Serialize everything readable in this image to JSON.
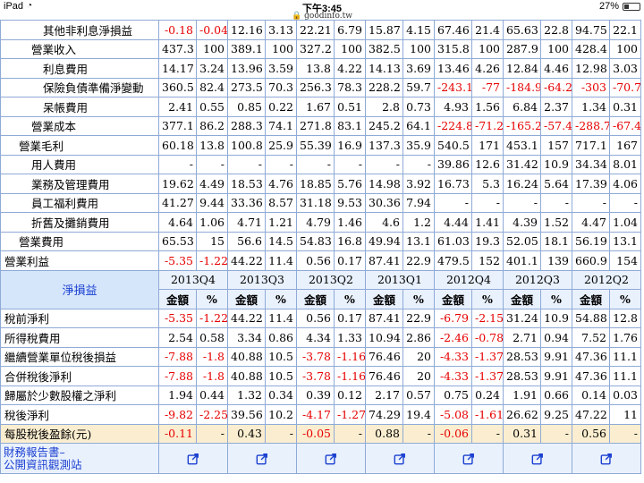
{
  "status_bar": {
    "device": "iPad",
    "time": "下午3:45",
    "url": "goodinfo.tw",
    "battery": "27%"
  },
  "income_rows": [
    {
      "label": "其他非利息淨損益",
      "indent": 3,
      "cells": [
        [
          "-0.18",
          true
        ],
        [
          "-0.04",
          true
        ],
        [
          "12.16",
          false
        ],
        [
          "3.13",
          false
        ],
        [
          "22.21",
          false
        ],
        [
          "6.79",
          false
        ],
        [
          "15.87",
          false
        ],
        [
          "4.15",
          false
        ],
        [
          "67.46",
          false
        ],
        [
          "21.4",
          false
        ],
        [
          "65.63",
          false
        ],
        [
          "22.8",
          false
        ],
        [
          "94.75",
          false
        ],
        [
          "22.1",
          false
        ]
      ]
    },
    {
      "label": "營業收入",
      "indent": 2,
      "cells": [
        [
          "437.3",
          false
        ],
        [
          "100",
          false
        ],
        [
          "389.1",
          false
        ],
        [
          "100",
          false
        ],
        [
          "327.2",
          false
        ],
        [
          "100",
          false
        ],
        [
          "382.5",
          false
        ],
        [
          "100",
          false
        ],
        [
          "315.8",
          false
        ],
        [
          "100",
          false
        ],
        [
          "287.9",
          false
        ],
        [
          "100",
          false
        ],
        [
          "428.4",
          false
        ],
        [
          "100",
          false
        ]
      ]
    },
    {
      "label": "利息費用",
      "indent": 3,
      "cells": [
        [
          "14.17",
          false
        ],
        [
          "3.24",
          false
        ],
        [
          "13.96",
          false
        ],
        [
          "3.59",
          false
        ],
        [
          "13.8",
          false
        ],
        [
          "4.22",
          false
        ],
        [
          "14.13",
          false
        ],
        [
          "3.69",
          false
        ],
        [
          "13.46",
          false
        ],
        [
          "4.26",
          false
        ],
        [
          "12.84",
          false
        ],
        [
          "4.46",
          false
        ],
        [
          "12.98",
          false
        ],
        [
          "3.03",
          false
        ]
      ]
    },
    {
      "label": "保險負債準備淨變動",
      "indent": 3,
      "cells": [
        [
          "360.5",
          false
        ],
        [
          "82.4",
          false
        ],
        [
          "273.5",
          false
        ],
        [
          "70.3",
          false
        ],
        [
          "256.3",
          false
        ],
        [
          "78.3",
          false
        ],
        [
          "228.2",
          false
        ],
        [
          "59.7",
          false
        ],
        [
          "-243.1",
          true
        ],
        [
          "-77",
          true
        ],
        [
          "-184.9",
          true
        ],
        [
          "-64.2",
          true
        ],
        [
          "-303",
          true
        ],
        [
          "-70.7",
          true
        ]
      ]
    },
    {
      "label": "呆帳費用",
      "indent": 3,
      "cells": [
        [
          "2.41",
          false
        ],
        [
          "0.55",
          false
        ],
        [
          "0.85",
          false
        ],
        [
          "0.22",
          false
        ],
        [
          "1.67",
          false
        ],
        [
          "0.51",
          false
        ],
        [
          "2.8",
          false
        ],
        [
          "0.73",
          false
        ],
        [
          "4.93",
          false
        ],
        [
          "1.56",
          false
        ],
        [
          "6.84",
          false
        ],
        [
          "2.37",
          false
        ],
        [
          "1.34",
          false
        ],
        [
          "0.31",
          false
        ]
      ]
    },
    {
      "label": "營業成本",
      "indent": 2,
      "cells": [
        [
          "377.1",
          false
        ],
        [
          "86.2",
          false
        ],
        [
          "288.3",
          false
        ],
        [
          "74.1",
          false
        ],
        [
          "271.8",
          false
        ],
        [
          "83.1",
          false
        ],
        [
          "245.2",
          false
        ],
        [
          "64.1",
          false
        ],
        [
          "-224.8",
          true
        ],
        [
          "-71.2",
          true
        ],
        [
          "-165.2",
          true
        ],
        [
          "-57.4",
          true
        ],
        [
          "-288.7",
          true
        ],
        [
          "-67.4",
          true
        ]
      ]
    },
    {
      "label": "營業毛利",
      "indent": 1,
      "cells": [
        [
          "60.18",
          false
        ],
        [
          "13.8",
          false
        ],
        [
          "100.8",
          false
        ],
        [
          "25.9",
          false
        ],
        [
          "55.39",
          false
        ],
        [
          "16.9",
          false
        ],
        [
          "137.3",
          false
        ],
        [
          "35.9",
          false
        ],
        [
          "540.5",
          false
        ],
        [
          "171",
          false
        ],
        [
          "453.1",
          false
        ],
        [
          "157",
          false
        ],
        [
          "717.1",
          false
        ],
        [
          "167",
          false
        ]
      ]
    },
    {
      "label": "用人費用",
      "indent": 2,
      "cells": [
        [
          "-",
          false
        ],
        [
          "-",
          false
        ],
        [
          "-",
          false
        ],
        [
          "-",
          false
        ],
        [
          "-",
          false
        ],
        [
          "-",
          false
        ],
        [
          "-",
          false
        ],
        [
          "-",
          false
        ],
        [
          "39.86",
          false
        ],
        [
          "12.6",
          false
        ],
        [
          "31.42",
          false
        ],
        [
          "10.9",
          false
        ],
        [
          "34.34",
          false
        ],
        [
          "8.01",
          false
        ]
      ]
    },
    {
      "label": "業務及管理費用",
      "indent": 2,
      "cells": [
        [
          "19.62",
          false
        ],
        [
          "4.49",
          false
        ],
        [
          "18.53",
          false
        ],
        [
          "4.76",
          false
        ],
        [
          "18.85",
          false
        ],
        [
          "5.76",
          false
        ],
        [
          "14.98",
          false
        ],
        [
          "3.92",
          false
        ],
        [
          "16.73",
          false
        ],
        [
          "5.3",
          false
        ],
        [
          "16.24",
          false
        ],
        [
          "5.64",
          false
        ],
        [
          "17.39",
          false
        ],
        [
          "4.06",
          false
        ]
      ]
    },
    {
      "label": "員工福利費用",
      "indent": 2,
      "cells": [
        [
          "41.27",
          false
        ],
        [
          "9.44",
          false
        ],
        [
          "33.36",
          false
        ],
        [
          "8.57",
          false
        ],
        [
          "31.18",
          false
        ],
        [
          "9.53",
          false
        ],
        [
          "30.36",
          false
        ],
        [
          "7.94",
          false
        ],
        [
          "-",
          false
        ],
        [
          "-",
          false
        ],
        [
          "-",
          false
        ],
        [
          "-",
          false
        ],
        [
          "-",
          false
        ],
        [
          "-",
          false
        ]
      ]
    },
    {
      "label": "折舊及攤銷費用",
      "indent": 2,
      "cells": [
        [
          "4.64",
          false
        ],
        [
          "1.06",
          false
        ],
        [
          "4.71",
          false
        ],
        [
          "1.21",
          false
        ],
        [
          "4.79",
          false
        ],
        [
          "1.46",
          false
        ],
        [
          "4.6",
          false
        ],
        [
          "1.2",
          false
        ],
        [
          "4.44",
          false
        ],
        [
          "1.41",
          false
        ],
        [
          "4.39",
          false
        ],
        [
          "1.52",
          false
        ],
        [
          "4.47",
          false
        ],
        [
          "1.04",
          false
        ]
      ]
    },
    {
      "label": "營業費用",
      "indent": 1,
      "cells": [
        [
          "65.53",
          false
        ],
        [
          "15",
          false
        ],
        [
          "56.6",
          false
        ],
        [
          "14.5",
          false
        ],
        [
          "54.83",
          false
        ],
        [
          "16.8",
          false
        ],
        [
          "49.94",
          false
        ],
        [
          "13.1",
          false
        ],
        [
          "61.03",
          false
        ],
        [
          "19.3",
          false
        ],
        [
          "52.05",
          false
        ],
        [
          "18.1",
          false
        ],
        [
          "56.19",
          false
        ],
        [
          "13.1",
          false
        ]
      ]
    },
    {
      "label": "營業利益",
      "indent": 0,
      "cells": [
        [
          "-5.35",
          true
        ],
        [
          "-1.22",
          true
        ],
        [
          "44.22",
          false
        ],
        [
          "11.4",
          false
        ],
        [
          "0.56",
          false
        ],
        [
          "0.17",
          false
        ],
        [
          "87.41",
          false
        ],
        [
          "22.9",
          false
        ],
        [
          "479.5",
          false
        ],
        [
          "152",
          false
        ],
        [
          "401.1",
          false
        ],
        [
          "139",
          false
        ],
        [
          "660.9",
          false
        ],
        [
          "154",
          false
        ]
      ]
    }
  ],
  "net_section": {
    "title": "淨損益",
    "quarters": [
      "2013Q4",
      "2013Q3",
      "2013Q2",
      "2013Q1",
      "2012Q4",
      "2012Q3",
      "2012Q2"
    ],
    "col_amount": "金額",
    "col_pct": "%"
  },
  "net_rows": [
    {
      "label": "稅前淨利",
      "cells": [
        [
          "-5.35",
          true
        ],
        [
          "-1.22",
          true
        ],
        [
          "44.22",
          false
        ],
        [
          "11.4",
          false
        ],
        [
          "0.56",
          false
        ],
        [
          "0.17",
          false
        ],
        [
          "87.41",
          false
        ],
        [
          "22.9",
          false
        ],
        [
          "-6.79",
          true
        ],
        [
          "-2.15",
          true
        ],
        [
          "31.24",
          false
        ],
        [
          "10.9",
          false
        ],
        [
          "54.88",
          false
        ],
        [
          "12.8",
          false
        ]
      ]
    },
    {
      "label": "所得稅費用",
      "cells": [
        [
          "2.54",
          false
        ],
        [
          "0.58",
          false
        ],
        [
          "3.34",
          false
        ],
        [
          "0.86",
          false
        ],
        [
          "4.34",
          false
        ],
        [
          "1.33",
          false
        ],
        [
          "10.94",
          false
        ],
        [
          "2.86",
          false
        ],
        [
          "-2.46",
          true
        ],
        [
          "-0.78",
          true
        ],
        [
          "2.71",
          false
        ],
        [
          "0.94",
          false
        ],
        [
          "7.52",
          false
        ],
        [
          "1.76",
          false
        ]
      ]
    },
    {
      "label": "繼續營業單位稅後損益",
      "cells": [
        [
          "-7.88",
          true
        ],
        [
          "-1.8",
          true
        ],
        [
          "40.88",
          false
        ],
        [
          "10.5",
          false
        ],
        [
          "-3.78",
          true
        ],
        [
          "-1.16",
          true
        ],
        [
          "76.46",
          false
        ],
        [
          "20",
          false
        ],
        [
          "-4.33",
          true
        ],
        [
          "-1.37",
          true
        ],
        [
          "28.53",
          false
        ],
        [
          "9.91",
          false
        ],
        [
          "47.36",
          false
        ],
        [
          "11.1",
          false
        ]
      ]
    },
    {
      "label": "合併稅後淨利",
      "cells": [
        [
          "-7.88",
          true
        ],
        [
          "-1.8",
          true
        ],
        [
          "40.88",
          false
        ],
        [
          "10.5",
          false
        ],
        [
          "-3.78",
          true
        ],
        [
          "-1.16",
          true
        ],
        [
          "76.46",
          false
        ],
        [
          "20",
          false
        ],
        [
          "-4.33",
          true
        ],
        [
          "-1.37",
          true
        ],
        [
          "28.53",
          false
        ],
        [
          "9.91",
          false
        ],
        [
          "47.36",
          false
        ],
        [
          "11.1",
          false
        ]
      ]
    },
    {
      "label": "歸屬於少數股權之淨利",
      "cells": [
        [
          "1.94",
          false
        ],
        [
          "0.44",
          false
        ],
        [
          "1.32",
          false
        ],
        [
          "0.34",
          false
        ],
        [
          "0.39",
          false
        ],
        [
          "0.12",
          false
        ],
        [
          "2.17",
          false
        ],
        [
          "0.57",
          false
        ],
        [
          "0.75",
          false
        ],
        [
          "0.24",
          false
        ],
        [
          "1.91",
          false
        ],
        [
          "0.66",
          false
        ],
        [
          "0.14",
          false
        ],
        [
          "0.03",
          false
        ]
      ]
    },
    {
      "label": "稅後淨利",
      "cells": [
        [
          "-9.82",
          true
        ],
        [
          "-2.25",
          true
        ],
        [
          "39.56",
          false
        ],
        [
          "10.2",
          false
        ],
        [
          "-4.17",
          true
        ],
        [
          "-1.27",
          true
        ],
        [
          "74.29",
          false
        ],
        [
          "19.4",
          false
        ],
        [
          "-5.08",
          true
        ],
        [
          "-1.61",
          true
        ],
        [
          "26.62",
          false
        ],
        [
          "9.25",
          false
        ],
        [
          "47.22",
          false
        ],
        [
          "11",
          false
        ]
      ]
    }
  ],
  "eps_row": {
    "label": "每股稅後盈餘(元)",
    "cells": [
      [
        "-0.11",
        true
      ],
      [
        "-",
        false
      ],
      [
        "0.43",
        false
      ],
      [
        "-",
        false
      ],
      [
        "-0.05",
        true
      ],
      [
        "-",
        false
      ],
      [
        "0.88",
        false
      ],
      [
        "-",
        false
      ],
      [
        "-0.06",
        true
      ],
      [
        "-",
        false
      ],
      [
        "0.31",
        false
      ],
      [
        "-",
        false
      ],
      [
        "0.56",
        false
      ],
      [
        "-",
        false
      ]
    ]
  },
  "report_link": {
    "label_line1": "財務報告書–",
    "label_line2": "公開資訊觀測站",
    "icon": "external-link-icon",
    "count": 7
  },
  "colors": {
    "negative": "#e60000",
    "link": "#1a3fd0",
    "border": "#8faad6",
    "header_bg": "#e9f1fd",
    "eps_bg": "#fbeed0"
  }
}
